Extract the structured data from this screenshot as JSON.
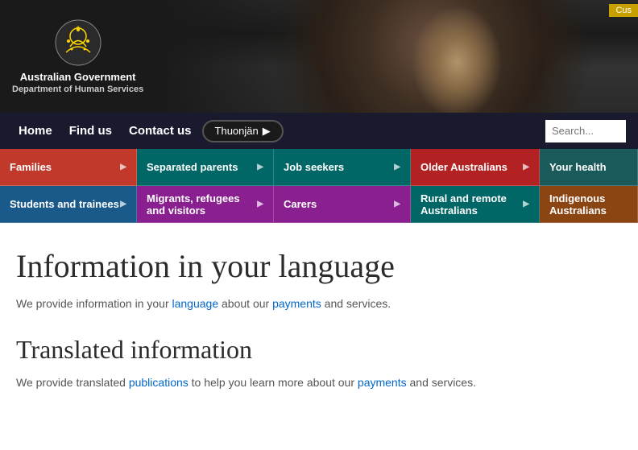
{
  "header": {
    "gov_name": "Australian Government",
    "dept_name": "Department of Human Services",
    "cust_badge": "Cus"
  },
  "nav": {
    "home": "Home",
    "find_us": "Find us",
    "contact_us": "Contact us",
    "lang_btn": "Thuonjän",
    "lang_arrow": "▶"
  },
  "menu": {
    "row1": [
      {
        "label": "Families",
        "hasArrow": true,
        "style": "cell-families"
      },
      {
        "label": "Separated parents",
        "hasArrow": true,
        "style": "cell-separated"
      },
      {
        "label": "Job seekers",
        "hasArrow": true,
        "style": "cell-jobseekers"
      },
      {
        "label": "Older Australians",
        "hasArrow": true,
        "style": "cell-older"
      },
      {
        "label": "Your health",
        "hasArrow": false,
        "style": "cell-yourhealth"
      }
    ],
    "row2": [
      {
        "label": "Students and trainees",
        "hasArrow": true,
        "style": "cell-students"
      },
      {
        "label": "Migrants, refugees and visitors",
        "hasArrow": true,
        "style": "cell-migrants"
      },
      {
        "label": "Carers",
        "hasArrow": true,
        "style": "cell-carers"
      },
      {
        "label": "Rural and remote Australians",
        "hasArrow": true,
        "style": "cell-rural"
      },
      {
        "label": "Indigenous Australians",
        "hasArrow": false,
        "style": "cell-indigenous"
      }
    ]
  },
  "main": {
    "title": "Information in your language",
    "subtitle": "We provide information in your language about our payments and services.",
    "section1_title": "Translated information",
    "section1_subtitle": "We provide translated publications to help you learn more about our payments and services."
  }
}
